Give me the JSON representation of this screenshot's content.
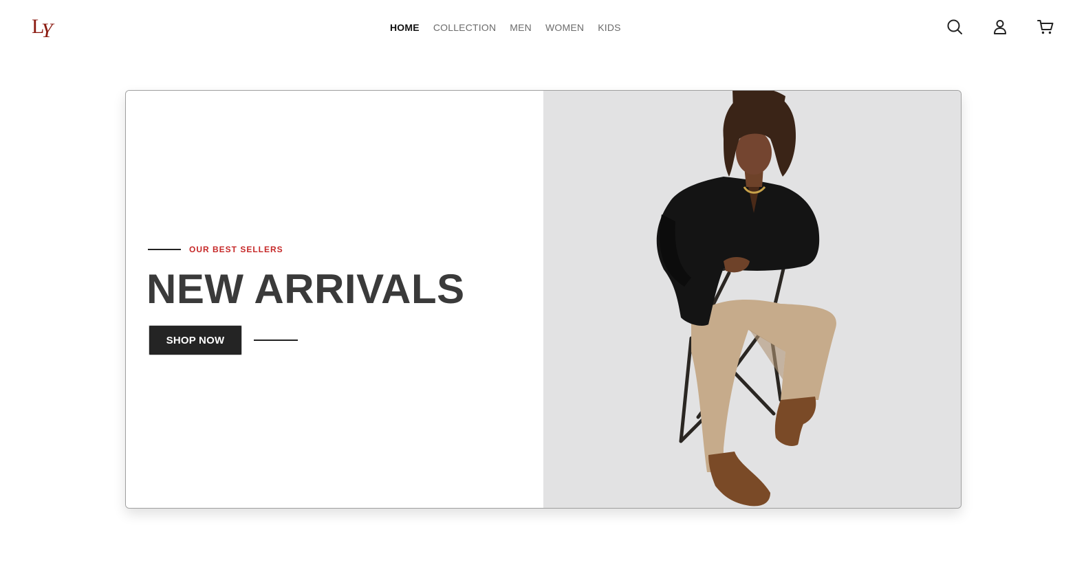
{
  "brand": {
    "logo_text": "LY",
    "logo_color": "#8b1a10"
  },
  "nav": {
    "items": [
      {
        "label": "HOME",
        "active": true
      },
      {
        "label": "COLLECTION",
        "active": false
      },
      {
        "label": "MEN",
        "active": false
      },
      {
        "label": "WOMEN",
        "active": false
      },
      {
        "label": "KIDS",
        "active": false
      }
    ]
  },
  "header_icons": [
    "search-icon",
    "user-icon",
    "cart-icon"
  ],
  "hero": {
    "eyebrow": "OUR BEST SELLERS",
    "title": "NEW ARRIVALS",
    "cta_label": "SHOP NOW",
    "accent_color": "#c62828",
    "image_subject": "model-seated-on-folding-chair"
  }
}
